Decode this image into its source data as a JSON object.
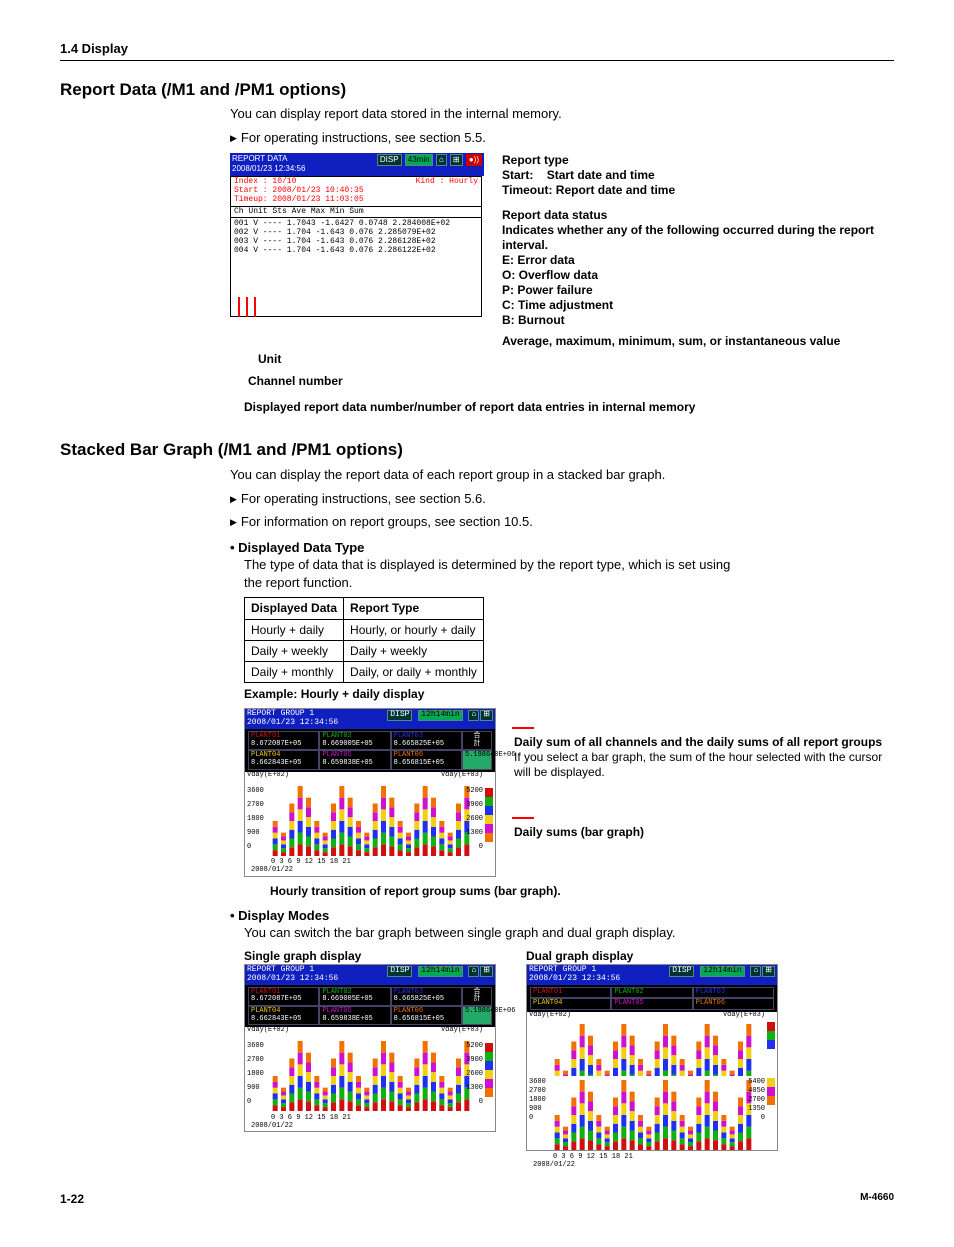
{
  "header": {
    "section": "1.4  Display"
  },
  "s1": {
    "title": "Report Data (/M1 and /PM1 options)",
    "intro": "You can display report data stored in the internal memory.",
    "ref": "For operating instructions, see section 5.5.",
    "fig": {
      "titleL": "REPORT DATA",
      "timestamp": "2008/01/23 12:34:56",
      "disp": "DISP",
      "interval": "43min",
      "index": "Index : 10/10",
      "kind": "Kind : Hourly",
      "start": "Start : 2008/01/23 10:40:35",
      "timeup": "Timeup: 2008/01/23 11:03:05",
      "cols": "Ch Unit  Sts       Ave       Max       Min       Sum",
      "rows": [
        "001 V    ----    1.7043   -1.6427    0.0748 2.284008E+02",
        "002 V    ----    1.704    -1.643     0.076  2.285079E+02",
        "003 V    ----    1.704    -1.643     0.076  2.286128E+02",
        "004 V    ----    1.704    -1.643     0.076  2.286122E+02"
      ]
    },
    "annot": {
      "report_type": "Report type",
      "start_l": "Start:",
      "start_r": "Start date and time",
      "timeout_l": "Timeout:",
      "timeout_r": "Report date and time",
      "status_t": "Report data status",
      "status_d": "Indicates whether any of the following occurred during the report interval.",
      "codes": [
        "E: Error data",
        "O: Overflow data",
        "P: Power failure",
        "C: Time adjustment",
        "B: Burnout"
      ],
      "avg": "Average, maximum, minimum, sum, or instantaneous value",
      "unit": "Unit",
      "chnum": "Channel number",
      "entries": "Displayed report data number/number of report data entries in internal memory"
    }
  },
  "s2": {
    "title": "Stacked Bar Graph (/M1 and /PM1 options)",
    "intro": "You can display the report data of each report group in a stacked bar graph.",
    "ref1": "For operating instructions, see section 5.6.",
    "ref2": "For information on report groups, see section 10.5.",
    "b1_head": "Displayed Data Type",
    "b1_body1": "The type of data that is displayed is determined by the report type, which is set using",
    "b1_body2": "the report function.",
    "table": {
      "h1": "Displayed Data",
      "h2": "Report Type",
      "rows": [
        [
          "Hourly + daily",
          "Hourly, or hourly + daily"
        ],
        [
          "Daily + weekly",
          "Daily + weekly"
        ],
        [
          "Daily + monthly",
          "Daily, or daily + monthly"
        ]
      ]
    },
    "example_caption": "Example: Hourly + daily display",
    "fig": {
      "titleL": "REPORT GROUP 1",
      "timestamp": "2008/01/23 12:34:56",
      "disp": "DISP",
      "interval": "12h14min",
      "plants": [
        {
          "n": "PLANT01",
          "v": "8.672087E+05"
        },
        {
          "n": "PLANT02",
          "v": "8.669005E+05"
        },
        {
          "n": "PLANT03",
          "v": "8.665825E+05"
        },
        {
          "n": "PLANT04",
          "v": "8.662843E+05"
        },
        {
          "n": "PLANT05",
          "v": "8.659838E+05"
        },
        {
          "n": "PLANT06",
          "v": "8.656815E+05"
        }
      ],
      "sum": "5.198640E+06",
      "left_axis": "Vday(E+02)",
      "right_axis": "Vday(E+03)",
      "left_ticks": [
        "3600",
        "2700",
        "1800",
        "900",
        "0"
      ],
      "right_ticks": [
        "5200",
        "3900",
        "2600",
        "1300",
        "0"
      ],
      "x_ticks": "0   3    6    9   12   15   18   21",
      "x_date": "2008/01/22"
    },
    "annot2": {
      "a1_b": "Daily sum of all channels and the daily sums of all report groups",
      "a1": "If you select a bar graph, the sum of the hour selected with the cursor will be displayed.",
      "a2_b": "Daily sums (bar graph)",
      "below": "Hourly transition of report group sums (bar graph)."
    },
    "b2_head": "Display Modes",
    "b2_body": "You can switch the bar graph between single graph and dual graph display.",
    "single_caption": "Single graph display",
    "dual_caption": "Dual graph display",
    "dual_fig": {
      "plants_top": [
        "PLANT01",
        "PLANT02",
        "PLANT03"
      ],
      "plants_bot": [
        "PLANT04",
        "PLANT05",
        "PLANT06"
      ],
      "left_ticks": [
        "3600",
        "2700",
        "1800",
        "900",
        "0"
      ],
      "right_ticks": [
        "5400",
        "4050",
        "2700",
        "1350",
        "0"
      ]
    }
  },
  "footer": {
    "page": "1-22",
    "doc": "M-4660"
  },
  "chart_data": {
    "type": "bar",
    "title": "Hourly transition of report group sums",
    "xlabel": "Hour (2008/01/22)",
    "ylabel_left": "Vday (E+02)",
    "ylabel_right": "Vday (E+03)",
    "x": [
      0,
      1,
      2,
      3,
      4,
      5,
      6,
      7,
      8,
      9,
      10,
      11,
      12,
      13,
      14,
      15,
      16,
      17,
      18,
      19,
      20,
      21,
      22,
      23
    ],
    "ylim_left": [
      0,
      3600
    ],
    "ylim_right": [
      0,
      5200
    ],
    "series": [
      {
        "name": "PLANT01",
        "color": "#d01010",
        "values": [
          300,
          200,
          450,
          600,
          500,
          300,
          200,
          450,
          600,
          500,
          300,
          200,
          450,
          600,
          500,
          300,
          200,
          450,
          600,
          500,
          300,
          200,
          450,
          600
        ]
      },
      {
        "name": "PLANT02",
        "color": "#10b010",
        "values": [
          300,
          200,
          450,
          600,
          500,
          300,
          200,
          450,
          600,
          500,
          300,
          200,
          450,
          600,
          500,
          300,
          200,
          450,
          600,
          500,
          300,
          200,
          450,
          600
        ]
      },
      {
        "name": "PLANT03",
        "color": "#2030f0",
        "values": [
          300,
          200,
          450,
          600,
          500,
          300,
          200,
          450,
          600,
          500,
          300,
          200,
          450,
          600,
          500,
          300,
          200,
          450,
          600,
          500,
          300,
          200,
          450,
          600
        ]
      },
      {
        "name": "PLANT04",
        "color": "#f0d010",
        "values": [
          300,
          200,
          450,
          600,
          500,
          300,
          200,
          450,
          600,
          500,
          300,
          200,
          450,
          600,
          500,
          300,
          200,
          450,
          600,
          500,
          300,
          200,
          450,
          600
        ]
      },
      {
        "name": "PLANT05",
        "color": "#d010d0",
        "values": [
          300,
          200,
          450,
          600,
          500,
          300,
          200,
          450,
          600,
          500,
          300,
          200,
          450,
          600,
          500,
          300,
          200,
          450,
          600,
          500,
          300,
          200,
          450,
          600
        ]
      },
      {
        "name": "PLANT06",
        "color": "#f07000",
        "values": [
          300,
          200,
          450,
          600,
          500,
          300,
          200,
          450,
          600,
          500,
          300,
          200,
          450,
          600,
          500,
          300,
          200,
          450,
          600,
          500,
          300,
          200,
          450,
          600
        ]
      }
    ],
    "daily_sums": {
      "PLANT01": 867208.7,
      "PLANT02": 866900.5,
      "PLANT03": 866582.5,
      "PLANT04": 866284.3,
      "PLANT05": 865983.8,
      "PLANT06": 865681.5,
      "total": 5198640.0
    }
  }
}
